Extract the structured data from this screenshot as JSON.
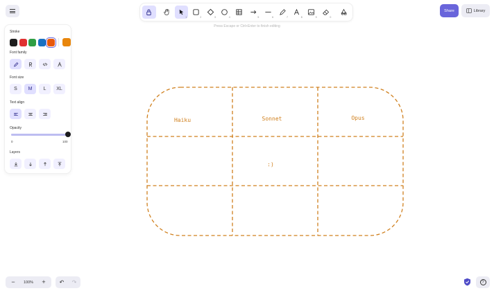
{
  "toolbar": {
    "tools": [
      {
        "name": "lock",
        "key": ""
      },
      {
        "name": "hand",
        "key": ""
      },
      {
        "name": "selection",
        "key": "1"
      },
      {
        "name": "rectangle",
        "key": "2"
      },
      {
        "name": "diamond",
        "key": "3"
      },
      {
        "name": "ellipse",
        "key": "4"
      },
      {
        "name": "arrow",
        "key": "5"
      },
      {
        "name": "line",
        "key": "6"
      },
      {
        "name": "draw",
        "key": "7"
      },
      {
        "name": "text",
        "key": "8"
      },
      {
        "name": "image",
        "key": "9"
      },
      {
        "name": "eraser",
        "key": "0"
      },
      {
        "name": "more-tools",
        "key": ""
      }
    ],
    "active_tool": "selection"
  },
  "hint": "Press Escape or Ctrl+Enter to finish editing",
  "header": {
    "share_label": "Share",
    "library_label": "Library"
  },
  "props": {
    "stroke_label": "Stroke",
    "stroke_colors": [
      "#1e1e1e",
      "#e03131",
      "#2f9e44",
      "#1971c2",
      "#e8590c"
    ],
    "selected_stroke": "#e8590c",
    "current_color": "#e8860c",
    "font_family_label": "Font family",
    "font_size_label": "Font size",
    "font_sizes": [
      "S",
      "M",
      "L",
      "XL"
    ],
    "selected_font_size": "M",
    "text_align_label": "Text align",
    "opacity_label": "Opacity",
    "opacity_min": "0",
    "opacity_max": "100",
    "opacity_value": 100,
    "layers_label": "Layers"
  },
  "canvas": {
    "table": {
      "headers": [
        "Haiku",
        "Sonnet",
        "Opus"
      ],
      "rows": 3,
      "cols": 3,
      "editing_text": ":)",
      "stroke_color": "#d0801e"
    }
  },
  "footer": {
    "zoom": "100%"
  }
}
